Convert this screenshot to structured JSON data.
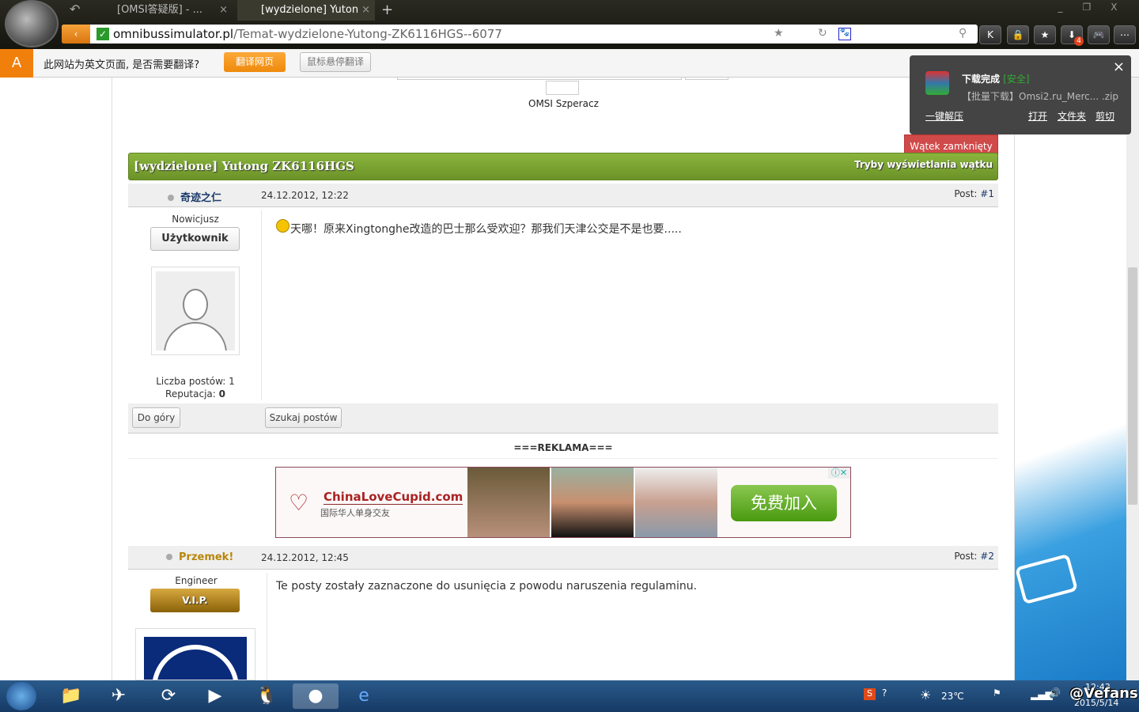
{
  "browser": {
    "tabs": [
      {
        "label": "[OMSI答疑版] - ...",
        "close": "×"
      },
      {
        "label": "[wydzielone] Yuton",
        "close": "×"
      }
    ],
    "new_tab": "+",
    "back": "‹",
    "url_domain": "omnibussimulator.pl",
    "url_path": "/Temat-wydzielone-Yutong-ZK6116HGS--6077",
    "toolbar": [
      "K",
      "🔒",
      "★",
      "⬇",
      "🎮",
      "⋯"
    ],
    "download_badge": "4",
    "window_controls": [
      "_",
      "❐",
      "X"
    ]
  },
  "translate_bar": {
    "icon": "A",
    "message": "此网站为英文页面, 是否需要翻译?",
    "translate_btn": "翻译网页",
    "hover_btn": "鼠标悬停翻译"
  },
  "download_popup": {
    "title": "下载完成",
    "safe": "[安全]",
    "file": "【批量下载】Omsi2.ru_Merc... .zip",
    "extract": "一键解压",
    "open": "打开",
    "folder": "文件夹",
    "cut": "剪切",
    "close": "×"
  },
  "header_banner": {
    "caption": "OMSI Szperacz"
  },
  "thread": {
    "closed_badge": "Wątek zamknięty",
    "title": "[wydzielone] Yutong ZK6116HGS",
    "view_modes": "Tryby wyświetlania wątku"
  },
  "posts": [
    {
      "author": "奇迹之仁",
      "date": "24.12.2012, 12:22",
      "num_label": "Post: ",
      "num": "#1",
      "rank": "Nowicjusz",
      "group": "Użytkownik",
      "posts_label": "Liczba postów: 1",
      "rep_label": "Reputacja: ",
      "rep": "0",
      "body": "天哪！原来Xingtonghe改造的巴士那么受欢迎？那我们天津公交是不是也要.....",
      "btn_top": "Do góry",
      "btn_search": "Szukaj postów"
    },
    {
      "author": "Przemek!",
      "date": "24.12.2012, 12:45",
      "num_label": "Post: ",
      "num": "#2",
      "rank": "Engineer",
      "group": "V.I.P.",
      "body": "Te posty zostały zaznaczone do usunięcia z powodu naruszenia regulaminu."
    }
  ],
  "ad": {
    "heading": "===REKLAMA===",
    "brand_a": "ChinaLove",
    "brand_b": "Cupid.com",
    "tagline": "国际华人单身交友",
    "cta": "免费加入"
  },
  "taskbar": {
    "temp": "23℃",
    "time": "12:43",
    "date": "2015/5/14",
    "watermark": "@Vefans"
  },
  "colors": {
    "green": "#7aa434",
    "closed": "#d04a4a",
    "vip": "#a8820f"
  }
}
